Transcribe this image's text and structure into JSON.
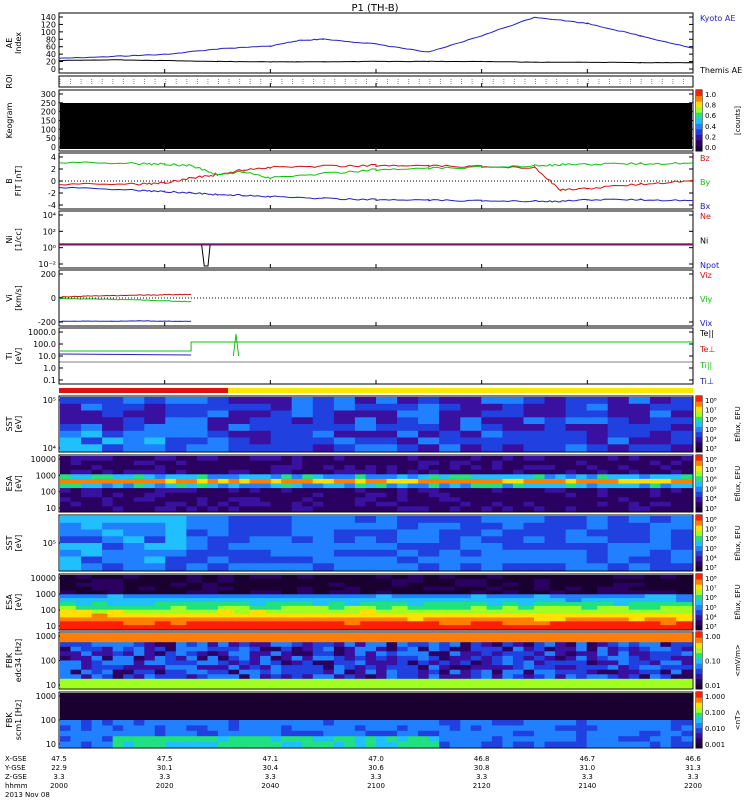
{
  "title": "P1 (TH-B)",
  "date_line": "2013 Nov 08",
  "time_labels": [
    "hhmm",
    "2000",
    "2020",
    "2040",
    "2100",
    "2120",
    "2140",
    "2200"
  ],
  "ephemeris": {
    "row_labels": [
      "X-GSE",
      "Y-GSE",
      "Z-GSE"
    ],
    "columns": [
      [
        "47.5",
        "22.9",
        "3.3"
      ],
      [
        "47.5",
        "30.1",
        "3.3"
      ],
      [
        "47.1",
        "30.4",
        "3.3"
      ],
      [
        "47.0",
        "30.6",
        "3.3"
      ],
      [
        "46.8",
        "30.8",
        "3.3"
      ],
      [
        "46.7",
        "31.0",
        "3.3"
      ],
      [
        "46.6",
        "31.3",
        "3.3"
      ]
    ]
  },
  "colors": {
    "blue": "#2020c0",
    "red": "#d01010",
    "green": "#10c010",
    "black": "#000000",
    "roi_bar_red": "#e01010",
    "roi_bar_yellow": "#ffe800"
  },
  "colorbars": {
    "keogram": {
      "ticks": [
        "1.0",
        "0.8",
        "0.6",
        "0.4",
        "0.2",
        "0.0"
      ],
      "label": "[counts]"
    },
    "eflux": {
      "ticks": [
        "10⁸",
        "10⁷",
        "10⁶",
        "10⁵",
        "10⁴",
        "10³"
      ],
      "label": "Eflux, EFU"
    },
    "fbk1": {
      "ticks": [
        "1.00",
        "0.10",
        "0.01"
      ],
      "label": "<mV/m>"
    },
    "fbk2": {
      "ticks": [
        "1.000",
        "0.100",
        "0.010",
        "0.001"
      ],
      "label": "<nT>"
    }
  },
  "chart_data": [
    {
      "panel": "ae",
      "type": "line",
      "ylabel": "AE Index",
      "yticks": [
        "140",
        "120",
        "100",
        "80",
        "60",
        "40",
        "20",
        "0"
      ],
      "ylim": [
        0,
        145
      ],
      "x": [
        0,
        10,
        20,
        30,
        40,
        45,
        50,
        60,
        70,
        80,
        90,
        100,
        110,
        120
      ],
      "series": [
        {
          "name": "Kyoto AE",
          "values": [
            35,
            40,
            45,
            58,
            65,
            78,
            82,
            70,
            50,
            90,
            135,
            120,
            90,
            60
          ]
        },
        {
          "name": "Themis AE",
          "values": [
            30,
            32,
            30,
            28,
            27,
            27,
            27,
            28,
            28,
            28,
            26,
            26,
            25,
            25
          ]
        }
      ]
    },
    {
      "panel": "roi",
      "type": "table",
      "ylabel": "ROI"
    },
    {
      "panel": "keogram",
      "type": "heatmap",
      "ylabel": "Keogram",
      "yticks": [
        "300",
        "250",
        "200",
        "150",
        "100",
        "50",
        "0"
      ]
    },
    {
      "panel": "bfield",
      "type": "line",
      "ylabel": "B FIT [nT]",
      "yticks": [
        "4",
        "2",
        "0",
        "-2",
        "-4"
      ],
      "ylim": [
        -4.5,
        4.5
      ],
      "x": [
        0,
        15,
        20,
        25,
        30,
        35,
        40,
        50,
        60,
        70,
        80,
        90,
        95,
        100,
        110,
        120
      ],
      "series": [
        {
          "name": "Bz",
          "values": [
            -0.5,
            -0.5,
            -0.3,
            0.5,
            1.0,
            1.8,
            2.2,
            2.4,
            2.5,
            2.4,
            2.3,
            2.2,
            -1.5,
            -1.2,
            -0.5,
            0.0
          ]
        },
        {
          "name": "By",
          "values": [
            3.0,
            2.8,
            2.7,
            2.5,
            1.0,
            1.5,
            0.5,
            1.2,
            1.8,
            2.0,
            2.2,
            2.5,
            2.6,
            2.7,
            2.8,
            2.8
          ]
        },
        {
          "name": "Bx",
          "values": [
            -1.0,
            -1.5,
            -1.7,
            -1.9,
            -2.2,
            -2.3,
            -2.5,
            -2.8,
            -3.0,
            -3.1,
            -3.2,
            -3.2,
            -3.3,
            -3.0,
            -3.0,
            -3.2
          ]
        }
      ]
    },
    {
      "panel": "density",
      "type": "line",
      "ylabel": "Ni [1/cc]",
      "yticks": [
        "10⁴",
        "10²",
        "10⁰",
        "10⁻²"
      ],
      "series": [
        {
          "name": "Ne",
          "values": []
        },
        {
          "name": "Ni",
          "values": []
        },
        {
          "name": "Npot",
          "values": []
        }
      ]
    },
    {
      "panel": "velocity",
      "type": "line",
      "ylabel": "Vi [km/s]",
      "yticks": [
        "200",
        "0",
        "-200"
      ],
      "ylim": [
        -300,
        300
      ],
      "x": [
        0,
        5,
        10,
        15,
        20,
        25
      ],
      "series": [
        {
          "name": "Viz",
          "values": [
            10,
            20,
            25,
            30,
            35,
            38
          ]
        },
        {
          "name": "Viy",
          "values": [
            -5,
            -10,
            -15,
            -20,
            -30,
            -40
          ]
        },
        {
          "name": "Vix",
          "values": [
            -250,
            -248,
            -250,
            -245,
            -248,
            -250
          ]
        }
      ]
    },
    {
      "panel": "temperature",
      "type": "line",
      "ylabel": "Ti [eV]",
      "yticks": [
        "1000.0",
        "100.0",
        "10.0",
        "1.0",
        "0.1"
      ],
      "series": [
        {
          "name": "Te||",
          "values": []
        },
        {
          "name": "Te⊥",
          "values": []
        },
        {
          "name": "Ti||",
          "values": []
        },
        {
          "name": "Ti⊥",
          "values": []
        }
      ]
    },
    {
      "panel": "sst_e",
      "type": "heatmap",
      "ylabel": "SST [eV]",
      "yticks": [
        "10⁵",
        "10⁴"
      ]
    },
    {
      "panel": "esa_e",
      "type": "heatmap",
      "ylabel": "ESA [eV]",
      "yticks": [
        "10000",
        "1000",
        "100",
        "10"
      ]
    },
    {
      "panel": "sst_i",
      "type": "heatmap",
      "ylabel": "SST [eV]",
      "yticks": [
        "10⁵"
      ]
    },
    {
      "panel": "esa_i",
      "type": "heatmap",
      "ylabel": "ESA [eV]",
      "yticks": [
        "10000",
        "1000",
        "100",
        "10"
      ]
    },
    {
      "panel": "fbk_e",
      "type": "heatmap",
      "ylabel": "FBK edc34 [Hz]",
      "yticks": [
        "1000",
        "100",
        "10"
      ]
    },
    {
      "panel": "fbk_b",
      "type": "heatmap",
      "ylabel": "FBK scm1 [Hz]",
      "yticks": [
        "1000",
        "100",
        "10"
      ]
    }
  ]
}
